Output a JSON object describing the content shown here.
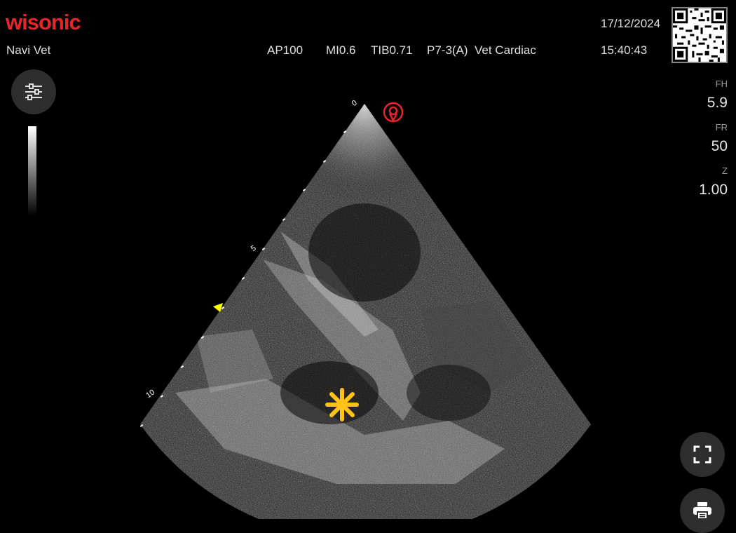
{
  "brand": {
    "logo_text": "wisonic",
    "color": "#e8262a"
  },
  "app": {
    "mode": "Navi Vet"
  },
  "header": {
    "acoustic_power": "AP100",
    "mechanical_index": "MI0.6",
    "thermal_index": "TIB0.71",
    "probe": "P7-3(A)",
    "preset": "Vet Cardiac",
    "date": "17/12/2024",
    "time": "15:40:43"
  },
  "side_params": [
    {
      "label": "FH",
      "value": "5.9"
    },
    {
      "label": "FR",
      "value": "50"
    },
    {
      "label": "Z",
      "value": "1.00"
    }
  ],
  "depth_scale": {
    "labels": [
      "0",
      "5",
      "10"
    ]
  },
  "icons": {
    "settings": "sliders-icon",
    "fullscreen": "fullscreen-icon",
    "print": "printer-icon",
    "orientation": "orientation-marker-icon",
    "focus": "focus-marker-icon",
    "annotation": "asterisk-icon"
  },
  "colors": {
    "orientation_marker": "#e8262a",
    "annotation": "#ffc21a",
    "focus_marker": "#ffff00"
  }
}
